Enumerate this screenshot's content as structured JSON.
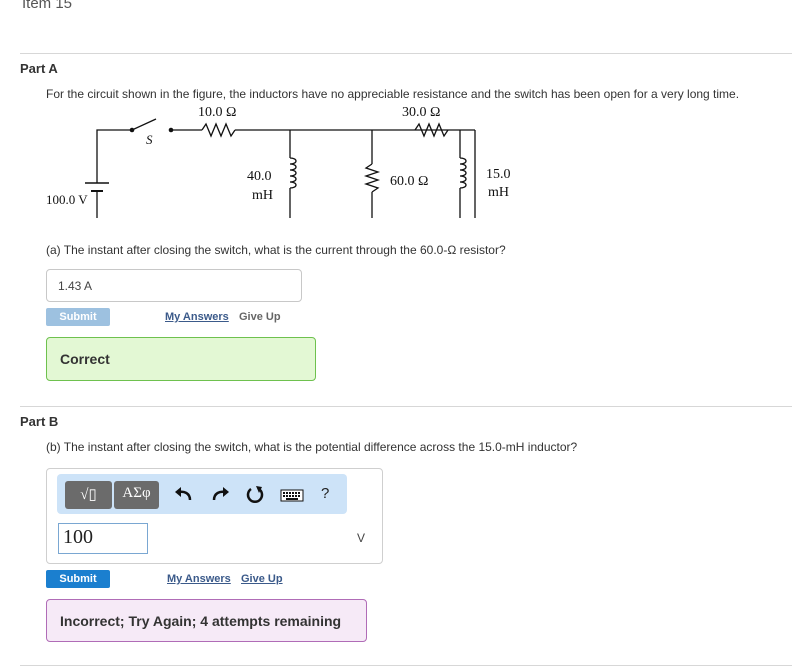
{
  "header": {
    "item_title": "Item 15"
  },
  "partA": {
    "title": "Part A",
    "problem_text": "For the circuit shown in the figure, the inductors have no appreciable resistance and the switch has been open for a very long time.",
    "circuit": {
      "resistor_1": "10.0 Ω",
      "resistor_2": "30.0 Ω",
      "switch_label": "S",
      "battery_label": "100.0 V",
      "inductor_1_value": "40.0",
      "inductor_1_unit": "mH",
      "resistor_3": "60.0 Ω",
      "inductor_2_value": "15.0",
      "inductor_2_unit": "mH"
    },
    "question": "(a) The instant after closing the switch, what is the current through the 60.0-Ω resistor?",
    "answer_value": "1.43  A",
    "submit_label": "Submit",
    "my_answers_label": "My Answers",
    "give_up_label": "Give Up",
    "feedback": "Correct"
  },
  "partB": {
    "title": "Part B",
    "question": "(b) The instant after closing the switch, what is the potential difference across the 15.0-mH inductor?",
    "toolbar": {
      "templates_label": "√▯",
      "symbols_label": "ΑΣφ",
      "undo_icon": "undo-icon",
      "redo_icon": "redo-icon",
      "reset_icon": "reset-icon",
      "keyboard_icon": "keyboard-icon",
      "help_label": "?"
    },
    "input_value": "100",
    "unit_label": "V",
    "submit_label": "Submit",
    "my_answers_label": "My Answers",
    "give_up_label": "Give Up",
    "feedback": "Incorrect; Try Again; 4 attempts remaining"
  },
  "colors": {
    "correct_bg": "#e3f8d4",
    "correct_border": "#6ec14e",
    "incorrect_bg": "#f6eaf7",
    "incorrect_border": "#b06cb7",
    "submit_active": "#1b7fcf",
    "submit_disabled": "#9dc1e0",
    "toolbar_bg": "#cde3f8"
  }
}
